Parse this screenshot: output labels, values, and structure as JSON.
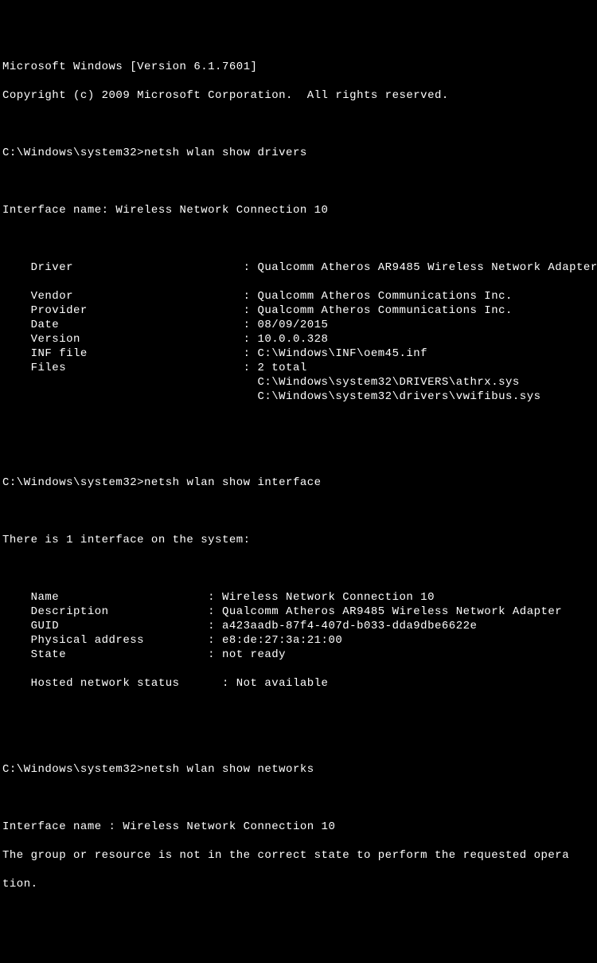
{
  "banner": {
    "line1": "Microsoft Windows [Version 6.1.7601]",
    "line2": "Copyright (c) 2009 Microsoft Corporation.  All rights reserved."
  },
  "sections": {
    "drivers": {
      "prompt": "C:\\Windows\\system32>",
      "cmd": "netsh wlan show drivers",
      "ifaceLine": "Interface name: Wireless Network Connection 10",
      "rows": [
        {
          "key": "Driver",
          "val": "Qualcomm Atheros AR9485 Wireless Network Adapter"
        },
        {
          "blank": true
        },
        {
          "key": "Vendor",
          "val": "Qualcomm Atheros Communications Inc."
        },
        {
          "key": "Provider",
          "val": "Qualcomm Atheros Communications Inc."
        },
        {
          "key": "Date",
          "val": "08/09/2015"
        },
        {
          "key": "Version",
          "val": "10.0.0.328"
        },
        {
          "key": "INF file",
          "val": "C:\\Windows\\INF\\oem45.inf"
        },
        {
          "key": "Files",
          "val": "2 total"
        },
        {
          "cont": true,
          "val": "C:\\Windows\\system32\\DRIVERS\\athrx.sys"
        },
        {
          "cont": true,
          "val": "C:\\Windows\\system32\\drivers\\vwifibus.sys"
        }
      ]
    },
    "iface": {
      "prompt": "C:\\Windows\\system32>",
      "cmd": "netsh wlan show interface",
      "countLine": "There is 1 interface on the system:",
      "rows": [
        {
          "key": "Name",
          "val": "Wireless Network Connection 10"
        },
        {
          "key": "Description",
          "val": "Qualcomm Atheros AR9485 Wireless Network Adapter"
        },
        {
          "key": "GUID",
          "val": "a423aadb-87f4-407d-b033-dda9dbe6622e"
        },
        {
          "key": "Physical address",
          "val": "e8:de:27:3a:21:00"
        },
        {
          "key": "State",
          "val": "not ready"
        },
        {
          "blank": true
        },
        {
          "key": "Hosted network status",
          "val": "Not available",
          "sep": "  : "
        }
      ]
    },
    "networks": {
      "prompt": "C:\\Windows\\system32>",
      "cmd": "netsh wlan show networks",
      "ifaceLine": "Interface name : Wireless Network Connection 10",
      "errLine1": "The group or resource is not in the correct state to perform the requested opera",
      "errLine2": "tion."
    }
  }
}
